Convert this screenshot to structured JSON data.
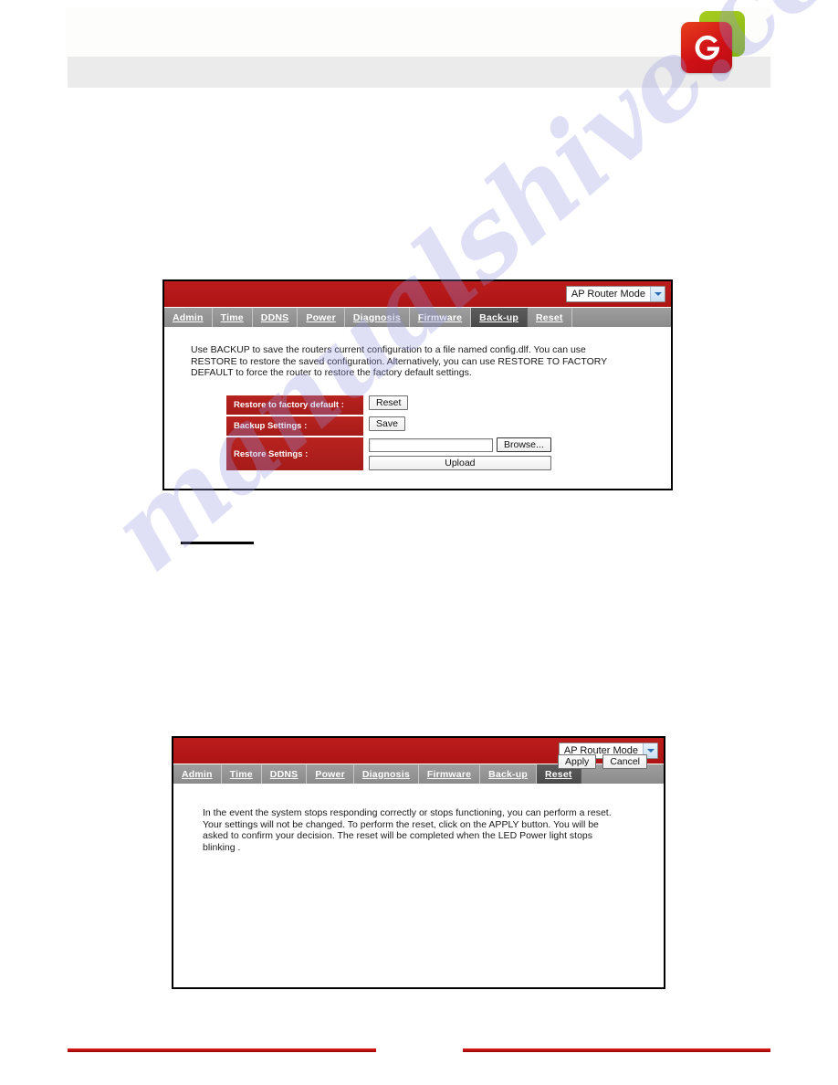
{
  "page": {
    "watermark": "manualshive.com",
    "logo": {
      "name": "engenius-e-logo",
      "red": "#cf1016",
      "green": "#8fbd16"
    }
  },
  "panels": [
    {
      "id": "backup",
      "mode_select": {
        "value": "AP Router Mode",
        "options": [
          "AP Router Mode"
        ],
        "arrow_icon": "chevron-down-icon"
      },
      "tabs": [
        {
          "label": "Admin",
          "active": false
        },
        {
          "label": "Time",
          "active": false
        },
        {
          "label": "DDNS",
          "active": false
        },
        {
          "label": "Power",
          "active": false
        },
        {
          "label": "Diagnosis",
          "active": false
        },
        {
          "label": "Firmware",
          "active": false
        },
        {
          "label": "Back-up",
          "active": true
        },
        {
          "label": "Reset",
          "active": false
        }
      ],
      "description": "Use BACKUP to save the routers current configuration to a file named config.dlf. You can use RESTORE to restore the saved configuration. Alternatively, you can use RESTORE TO FACTORY DEFAULT to force the router to restore the factory default settings.",
      "rows": [
        {
          "label": "Restore to factory default :",
          "button": "Reset"
        },
        {
          "label": "Backup Settings :",
          "button": "Save"
        },
        {
          "label": "Restore Settings :",
          "browse_button": "Browse...",
          "upload_button": "Upload",
          "file_value": ""
        }
      ]
    },
    {
      "id": "reset",
      "mode_select": {
        "value": "AP Router Mode",
        "options": [
          "AP Router Mode"
        ],
        "arrow_icon": "chevron-down-icon"
      },
      "tabs": [
        {
          "label": "Admin",
          "active": false
        },
        {
          "label": "Time",
          "active": false
        },
        {
          "label": "DDNS",
          "active": false
        },
        {
          "label": "Power",
          "active": false
        },
        {
          "label": "Diagnosis",
          "active": false
        },
        {
          "label": "Firmware",
          "active": false
        },
        {
          "label": "Back-up",
          "active": false
        },
        {
          "label": "Reset",
          "active": true
        }
      ],
      "description": "In the event the system stops responding correctly or stops functioning, you can perform a reset. Your settings will not be changed. To perform the reset, click on the APPLY button. You will be asked to confirm your decision. The reset will be completed when the LED Power light stops blinking .",
      "actions": {
        "apply": "Apply",
        "cancel": "Cancel"
      }
    }
  ]
}
